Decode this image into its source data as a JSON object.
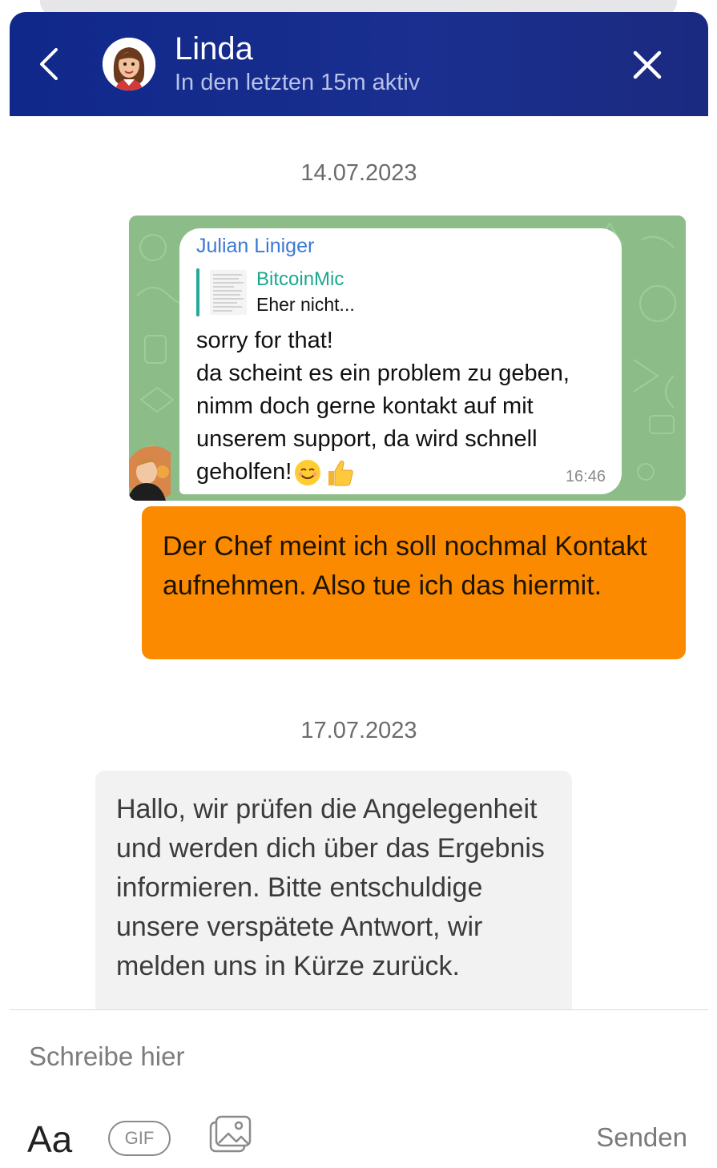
{
  "header": {
    "contact_name": "Linda",
    "contact_status": "In den letzten 15m aktiv",
    "back_icon": "chevron-left-icon",
    "close_icon": "close-icon",
    "background_color": "#10288a"
  },
  "messages": [
    {
      "date": "14.07.2023",
      "items": [
        {
          "type": "image",
          "telegram": {
            "sender": "Julian Liniger",
            "quote_name": "BitcoinMic",
            "quote_text": "Eher nicht...",
            "lines": [
              "sorry for that!",
              "da scheint es ein problem zu geben,",
              "nimm doch gerne kontakt auf mit",
              "unserem support, da wird schnell",
              "geholfen!"
            ],
            "time": "16:46"
          }
        },
        {
          "type": "outgoing",
          "color": "#fb8a00",
          "text": "Der Chef meint ich soll nochmal Kontakt aufnehmen. Also tue ich das hiermit."
        }
      ]
    },
    {
      "date": "17.07.2023",
      "items": [
        {
          "type": "incoming",
          "color": "#f2f2f2",
          "text": "Hallo, wir prüfen die Angelegenheit und werden dich über das Ergebnis informieren. Bitte entschuldige unsere verspätete Antwort, wir melden uns in Kürze zurück."
        }
      ]
    }
  ],
  "composer": {
    "placeholder": "Schreibe hier",
    "format_label": "Aa",
    "gif_label": "GIF",
    "image_icon": "image-icon",
    "send_label": "Senden"
  }
}
